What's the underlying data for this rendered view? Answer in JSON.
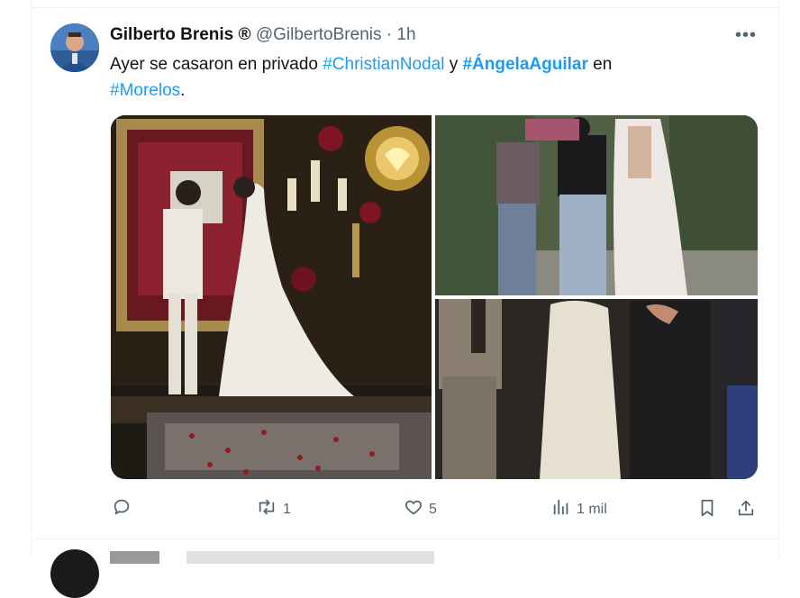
{
  "tweet": {
    "author_name": "Gilberto Brenis ®",
    "handle": "@GilbertoBrenis",
    "separator": "·",
    "time": "1h",
    "more_label": "•••",
    "text_parts": [
      {
        "text": "Ayer se casaron en privado ",
        "type": "plain"
      },
      {
        "text": "#ChristianNodal",
        "type": "hashtag"
      },
      {
        "text": " y ",
        "type": "plain"
      },
      {
        "text": "#ÁngelaAguilar",
        "type": "hashtag-bold"
      },
      {
        "text": " en ",
        "type": "plain"
      },
      {
        "text": "#Morelos",
        "type": "hashtag"
      },
      {
        "text": ".",
        "type": "plain"
      }
    ]
  },
  "actions": {
    "reply_count": "",
    "retweet_count": "1",
    "like_count": "5",
    "views_count": "1 mil"
  },
  "colors": {
    "accent": "#1d9bf0",
    "muted": "#536471",
    "text": "#0f1419",
    "border": "#eff3f4"
  },
  "icons": [
    "reply-icon",
    "retweet-icon",
    "like-icon",
    "views-icon",
    "bookmark-icon",
    "share-icon",
    "more-icon"
  ]
}
